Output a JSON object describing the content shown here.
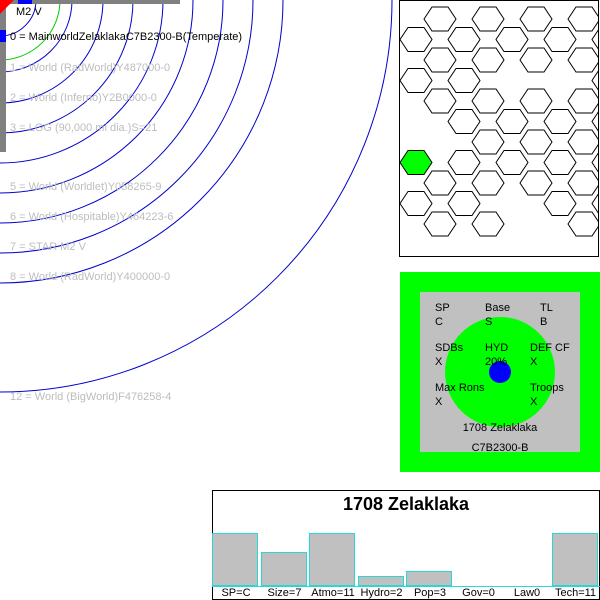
{
  "colors": {
    "orbit": "#0000cc",
    "habitable_zone": "#00cc00",
    "faint_text": "#bdbdbd",
    "accent_green": "#00ff00",
    "panel_grey": "#c0c0c0",
    "core_blue": "#0000ff",
    "bar_border": "#2bd6d6",
    "star_red": "#ff0000"
  },
  "system": {
    "star_label": "M2 V",
    "orbits": [
      "0 = MainworldZelaklakaC7B2300-B(Temperate)",
      "1 = World  (RadWorld)Y487000-0",
      "2 = World  (Inferno)Y2B0000-0",
      "3 = LGG (90,000 mi dia.)S=21",
      "5 = World  (Worldlet)Y058265-9",
      "6 = World  (Hospitable)Y464223-6",
      "7 = STAR M2 V",
      "8 = World  (RadWorld)Y400000-0",
      "12 = World  (BigWorld)F476258-4"
    ]
  },
  "hex_map": {
    "highlighted_hex": "green"
  },
  "world_card": {
    "sp_label": "SP",
    "sp_value": "C",
    "base_label": "Base",
    "base_value": "S",
    "tl_label": "TL",
    "tl_value": "B",
    "sdbs_label": "SDBs",
    "sdbs_value": "X",
    "hyd_label": "HYD",
    "hyd_value": "20%",
    "def_label": "DEF CF",
    "def_value": "X",
    "maxrons_label": "Max Rons",
    "maxrons_value": "X",
    "troops_label": "Troops",
    "troops_value": "X",
    "name": "1708 Zelaklaka",
    "uwp": "C7B2300-B"
  },
  "stats": {
    "title": "1708 Zelaklaka",
    "bars": [
      {
        "label": "SP=C",
        "level": 0.53
      },
      {
        "label": "Size=7",
        "level": 0.34
      },
      {
        "label": "Atmo=11",
        "level": 0.53
      },
      {
        "label": "Hydro=2",
        "level": 0.1
      },
      {
        "label": "Pop=3",
        "level": 0.15
      },
      {
        "label": "Gov=0",
        "level": 0.0
      },
      {
        "label": "Law0",
        "level": 0.0
      },
      {
        "label": "Tech=11",
        "level": 0.53
      }
    ]
  }
}
